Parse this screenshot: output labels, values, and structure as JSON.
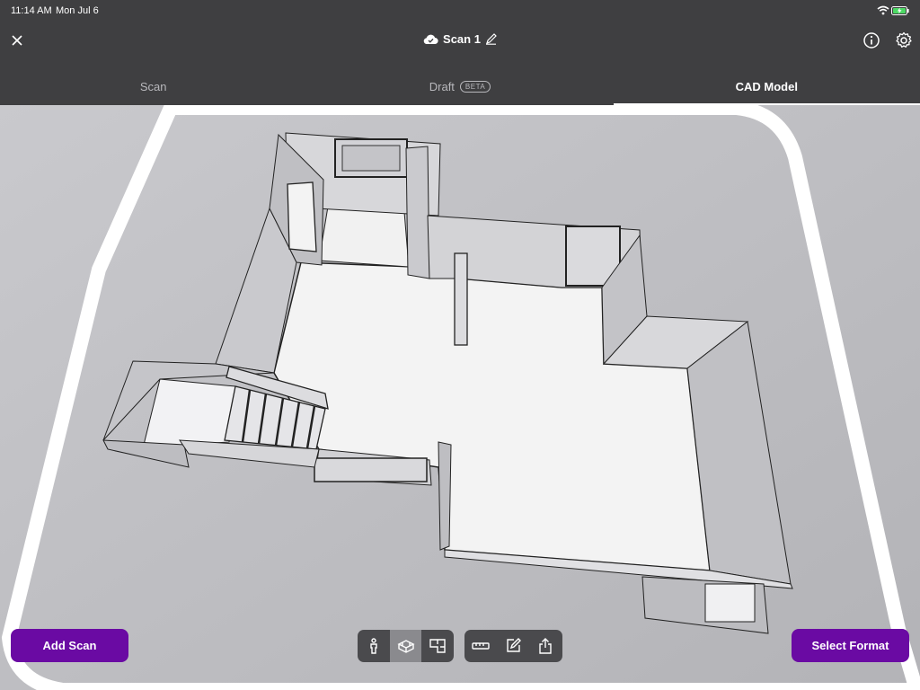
{
  "status": {
    "time": "11:14 AM",
    "date": "Mon Jul 6"
  },
  "header": {
    "title": "Scan 1"
  },
  "tabs": [
    {
      "label": "Scan",
      "active": false
    },
    {
      "label": "Draft",
      "badge": "BETA",
      "active": false
    },
    {
      "label": "CAD Model",
      "active": true
    }
  ],
  "buttons": {
    "add_scan": "Add Scan",
    "select_format": "Select Format"
  },
  "toolbar": {
    "view_tools": [
      "person-view-icon",
      "3d-model-icon",
      "floor-plan-icon"
    ],
    "selected_view": "3d-model-icon",
    "action_tools": [
      "measure-icon",
      "edit-icon",
      "share-icon"
    ]
  },
  "colors": {
    "accent": "#6a0aa3",
    "header": "#3f3f41",
    "floor": "#f3f3f3",
    "wall": "#cfcfd3"
  }
}
